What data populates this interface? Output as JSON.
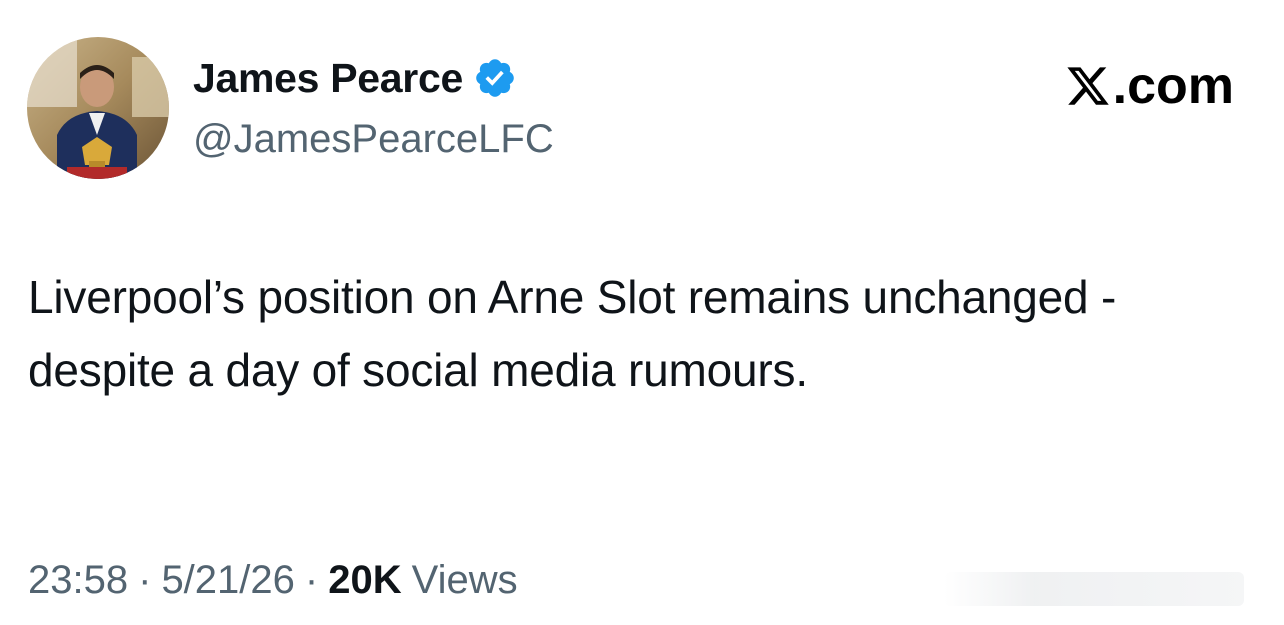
{
  "author": {
    "display_name": "James Pearce",
    "handle": "@JamesPearceLFC",
    "verified": true,
    "verified_icon": "verified-badge-icon",
    "verified_color": "#1d9bf0"
  },
  "brand": {
    "label": ".com",
    "logo_icon": "x-logo-icon"
  },
  "tweet": {
    "text": "Liverpool’s position on Arne Slot remains unchanged - despite a day of social media rumours."
  },
  "meta": {
    "time": "23:58",
    "date": "5/21/26",
    "separator": "·",
    "views_count": "20K",
    "views_label": "Views"
  },
  "colors": {
    "text_primary": "#0f1419",
    "text_secondary": "#536471",
    "background": "#ffffff"
  }
}
